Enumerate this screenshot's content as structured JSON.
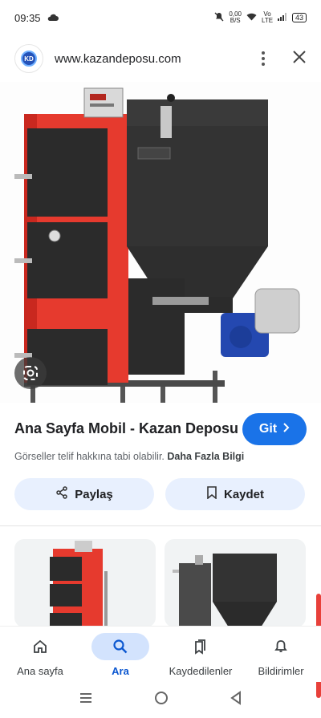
{
  "status_bar": {
    "time": "09:35",
    "net_speed": "0,00\nB/S",
    "network": "Vo LTE",
    "battery": "43"
  },
  "url_bar": {
    "logo_text": "KD",
    "url": "www.kazandeposu.com"
  },
  "result": {
    "title": "Ana Sayfa Mobil - Kazan Deposu",
    "go_label": "Git",
    "copyright_text": "Görseller telif hakkına tabi olabilir.",
    "more_info": "Daha Fazla Bilgi",
    "share_label": "Paylaş",
    "save_label": "Kaydet"
  },
  "bottom_nav": {
    "items": [
      {
        "label": "Ana sayfa",
        "icon": "home-icon"
      },
      {
        "label": "Ara",
        "icon": "search-icon"
      },
      {
        "label": "Kaydedilenler",
        "icon": "bookmarks-icon"
      },
      {
        "label": "Bildirimler",
        "icon": "bell-icon"
      }
    ],
    "active_index": 1
  },
  "colors": {
    "accent": "#1a73e8",
    "boiler_red": "#e63a2e",
    "boiler_dark": "#2b2b2b"
  }
}
